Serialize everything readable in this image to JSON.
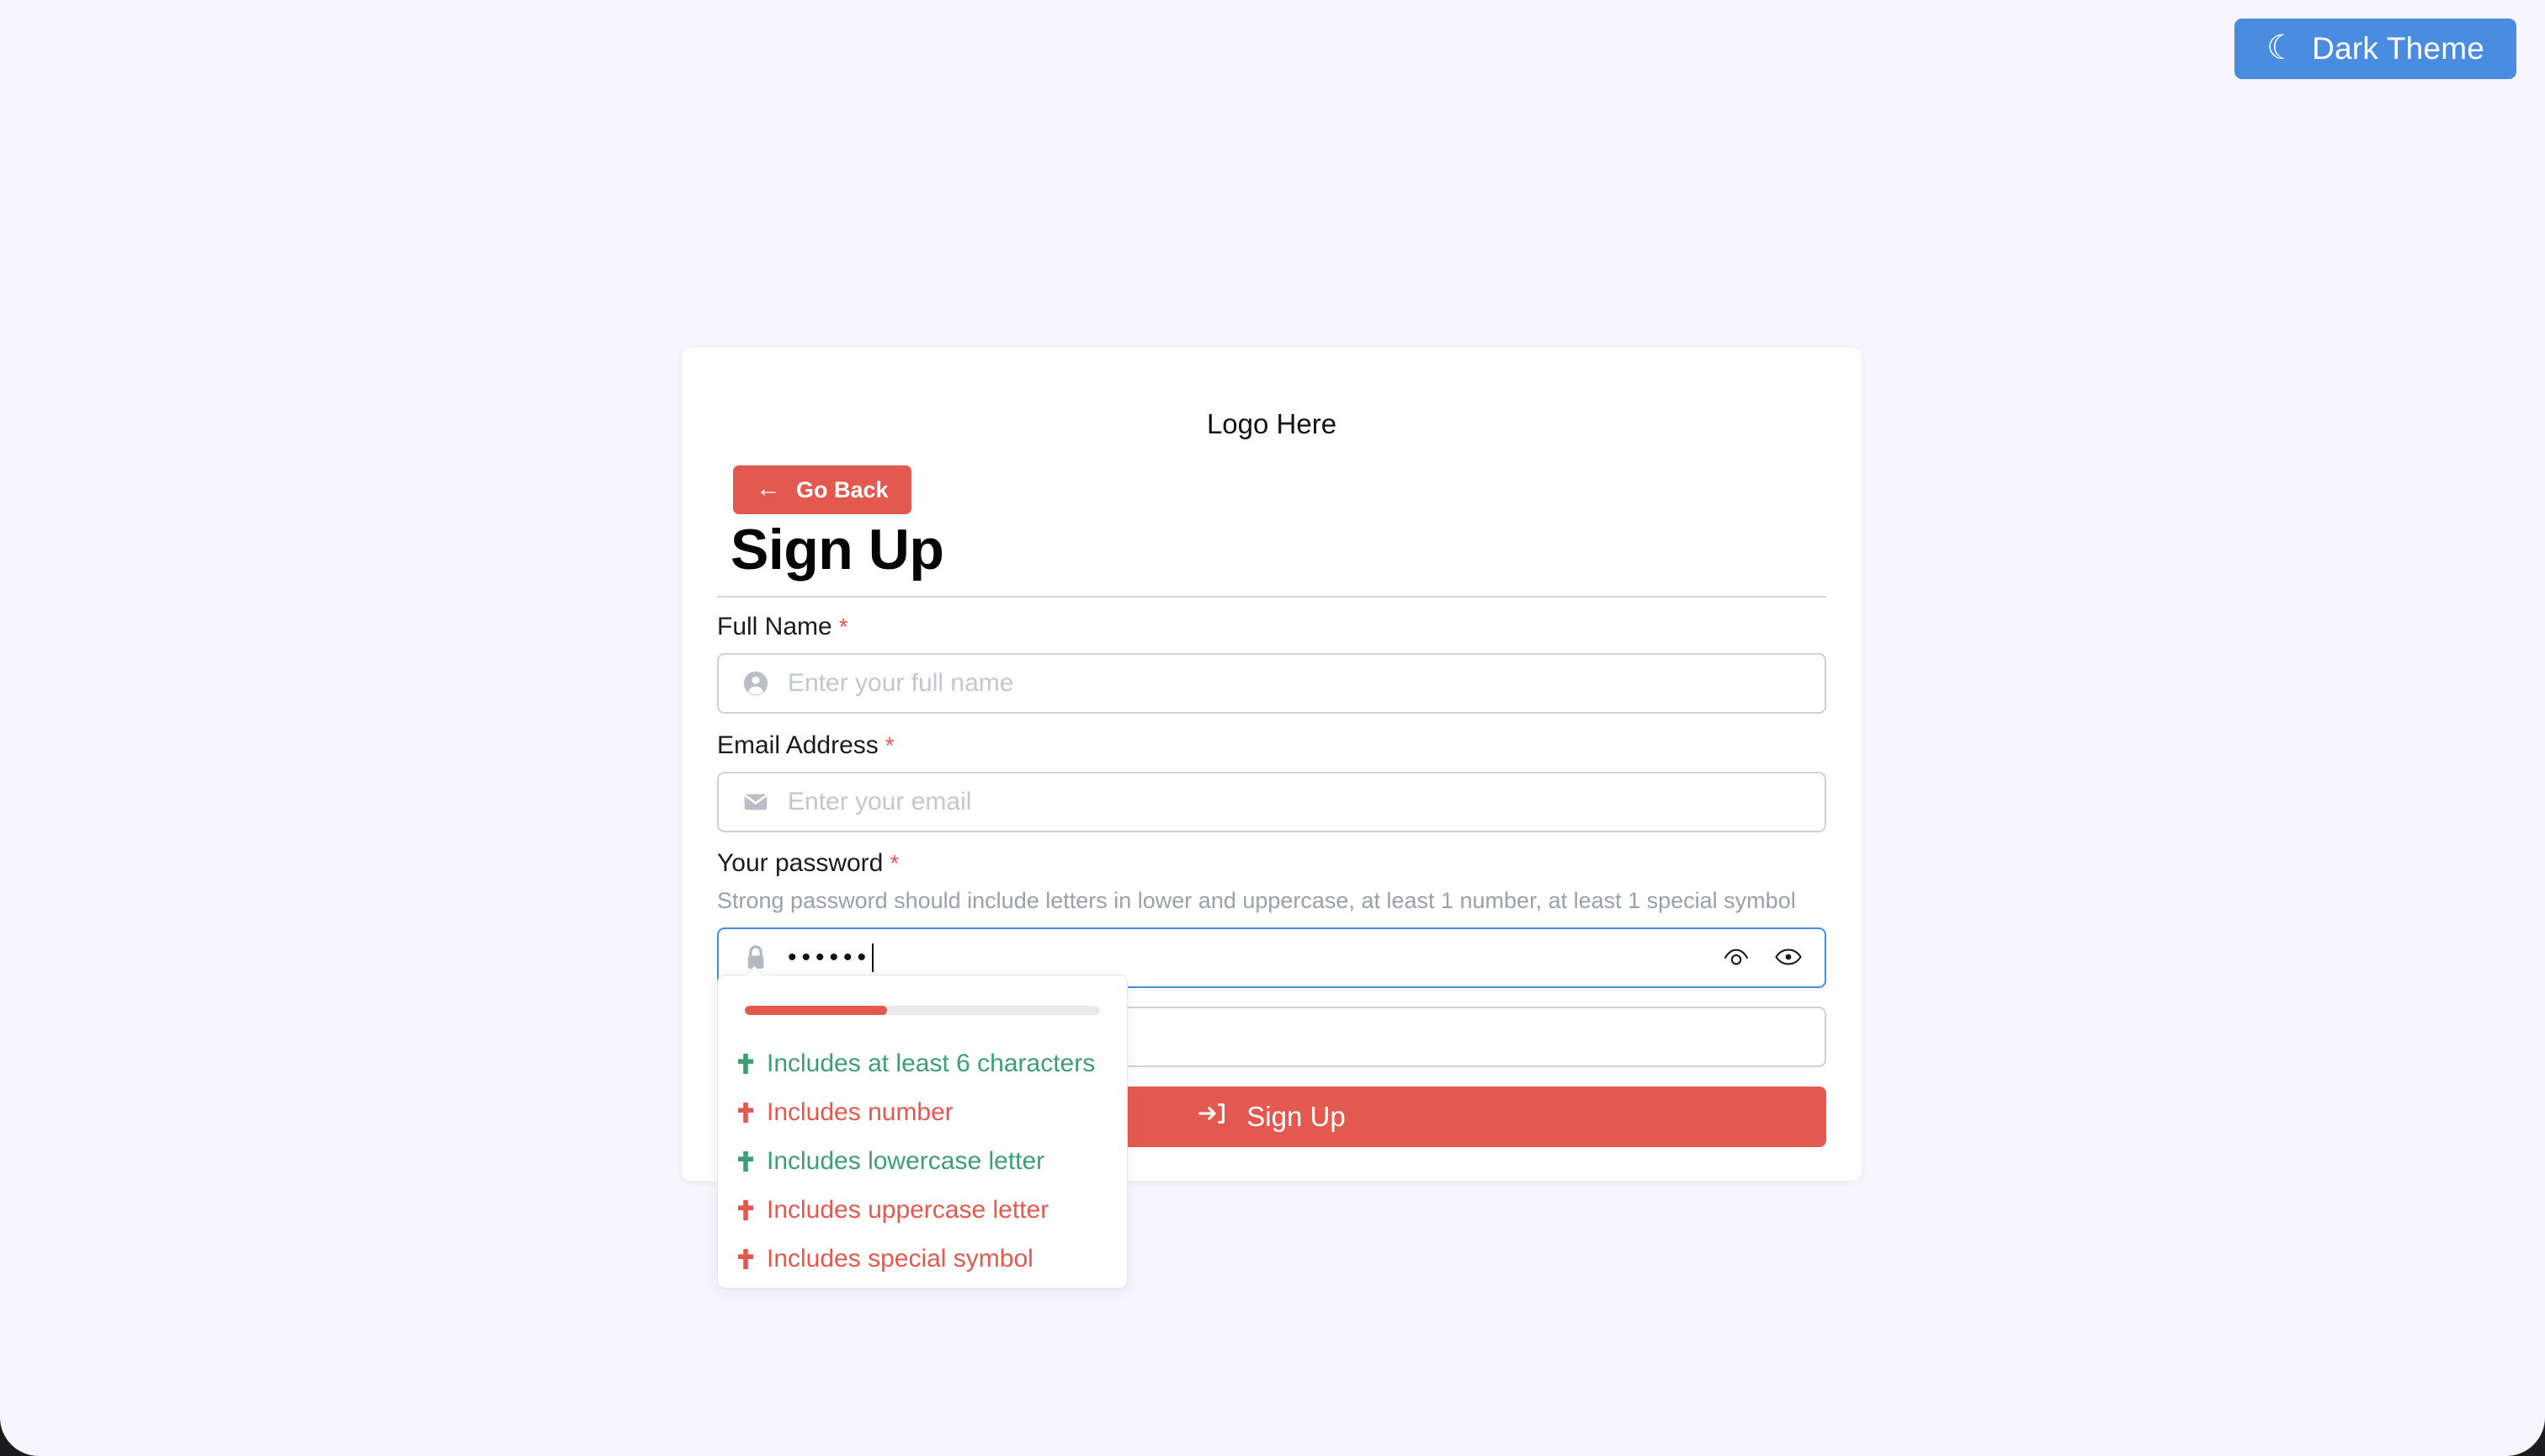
{
  "theme_toggle": {
    "label": "Dark Theme",
    "icon": "moon-icon",
    "glyph": "☾",
    "bg": "#4a8ce0"
  },
  "card": {
    "logo_text": "Logo Here",
    "go_back": {
      "label": "Go Back",
      "icon": "arrow-left-icon",
      "glyph": "←",
      "bg": "#e3594f"
    },
    "title": "Sign Up"
  },
  "form": {
    "full_name": {
      "label": "Full Name",
      "required_mark": "*",
      "placeholder": "Enter your full name",
      "value": "",
      "icon": "user-icon"
    },
    "email": {
      "label": "Email Address",
      "required_mark": "*",
      "placeholder": "Enter your email",
      "value": "",
      "icon": "envelope-icon"
    },
    "password": {
      "label": "Your password",
      "required_mark": "*",
      "hint": "Strong password should include letters in lower and uppercase, at least 1 number, at least 1 special symbol",
      "value": "••••••",
      "masked_length": 6,
      "placeholder": "",
      "icon": "lock-icon",
      "focused": true,
      "toggle_hide_icon": "eye-off-icon",
      "toggle_show_icon": "eye-icon"
    },
    "confirm_password": {
      "label": "",
      "placeholder": "",
      "value": "",
      "icon": "lock-icon"
    },
    "submit": {
      "label": "Sign Up",
      "icon": "sign-in-icon",
      "bg": "#e3594f"
    }
  },
  "password_popup": {
    "strength_percent": 40,
    "strength_color": "#e3594f",
    "track_color": "#e9eaec",
    "pass_color": "#3f9d76",
    "fail_color": "#e3594f",
    "rules": [
      {
        "text": "Includes at least 6 characters",
        "met": true,
        "icon": "cross-check-icon"
      },
      {
        "text": "Includes number",
        "met": false,
        "icon": "cross-check-icon"
      },
      {
        "text": "Includes lowercase letter",
        "met": true,
        "icon": "cross-check-icon"
      },
      {
        "text": "Includes uppercase letter",
        "met": false,
        "icon": "cross-check-icon"
      },
      {
        "text": "Includes special symbol",
        "met": false,
        "icon": "cross-check-icon"
      }
    ]
  }
}
